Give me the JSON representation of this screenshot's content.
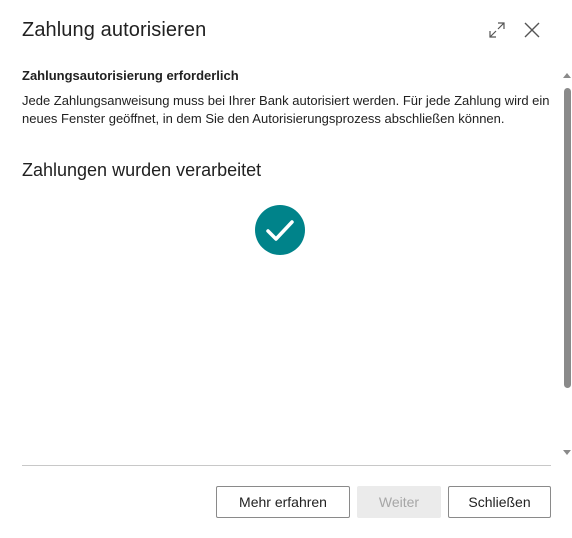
{
  "dialog": {
    "title": "Zahlung autorisieren",
    "subheading": "Zahlungsautorisierung erforderlich",
    "description": "Jede Zahlungsanweisung muss bei Ihrer Bank autorisiert werden. Für jede Zahlung wird ein neues Fenster geöffnet, in dem Sie den Autorisierungsprozess abschließen können.",
    "status_heading": "Zahlungen wurden verarbeitet",
    "status_icon": "checkmark-circle-icon",
    "accent_color": "#00838a"
  },
  "buttons": {
    "learn_more": "Mehr erfahren",
    "next": "Weiter",
    "close": "Schließen"
  }
}
